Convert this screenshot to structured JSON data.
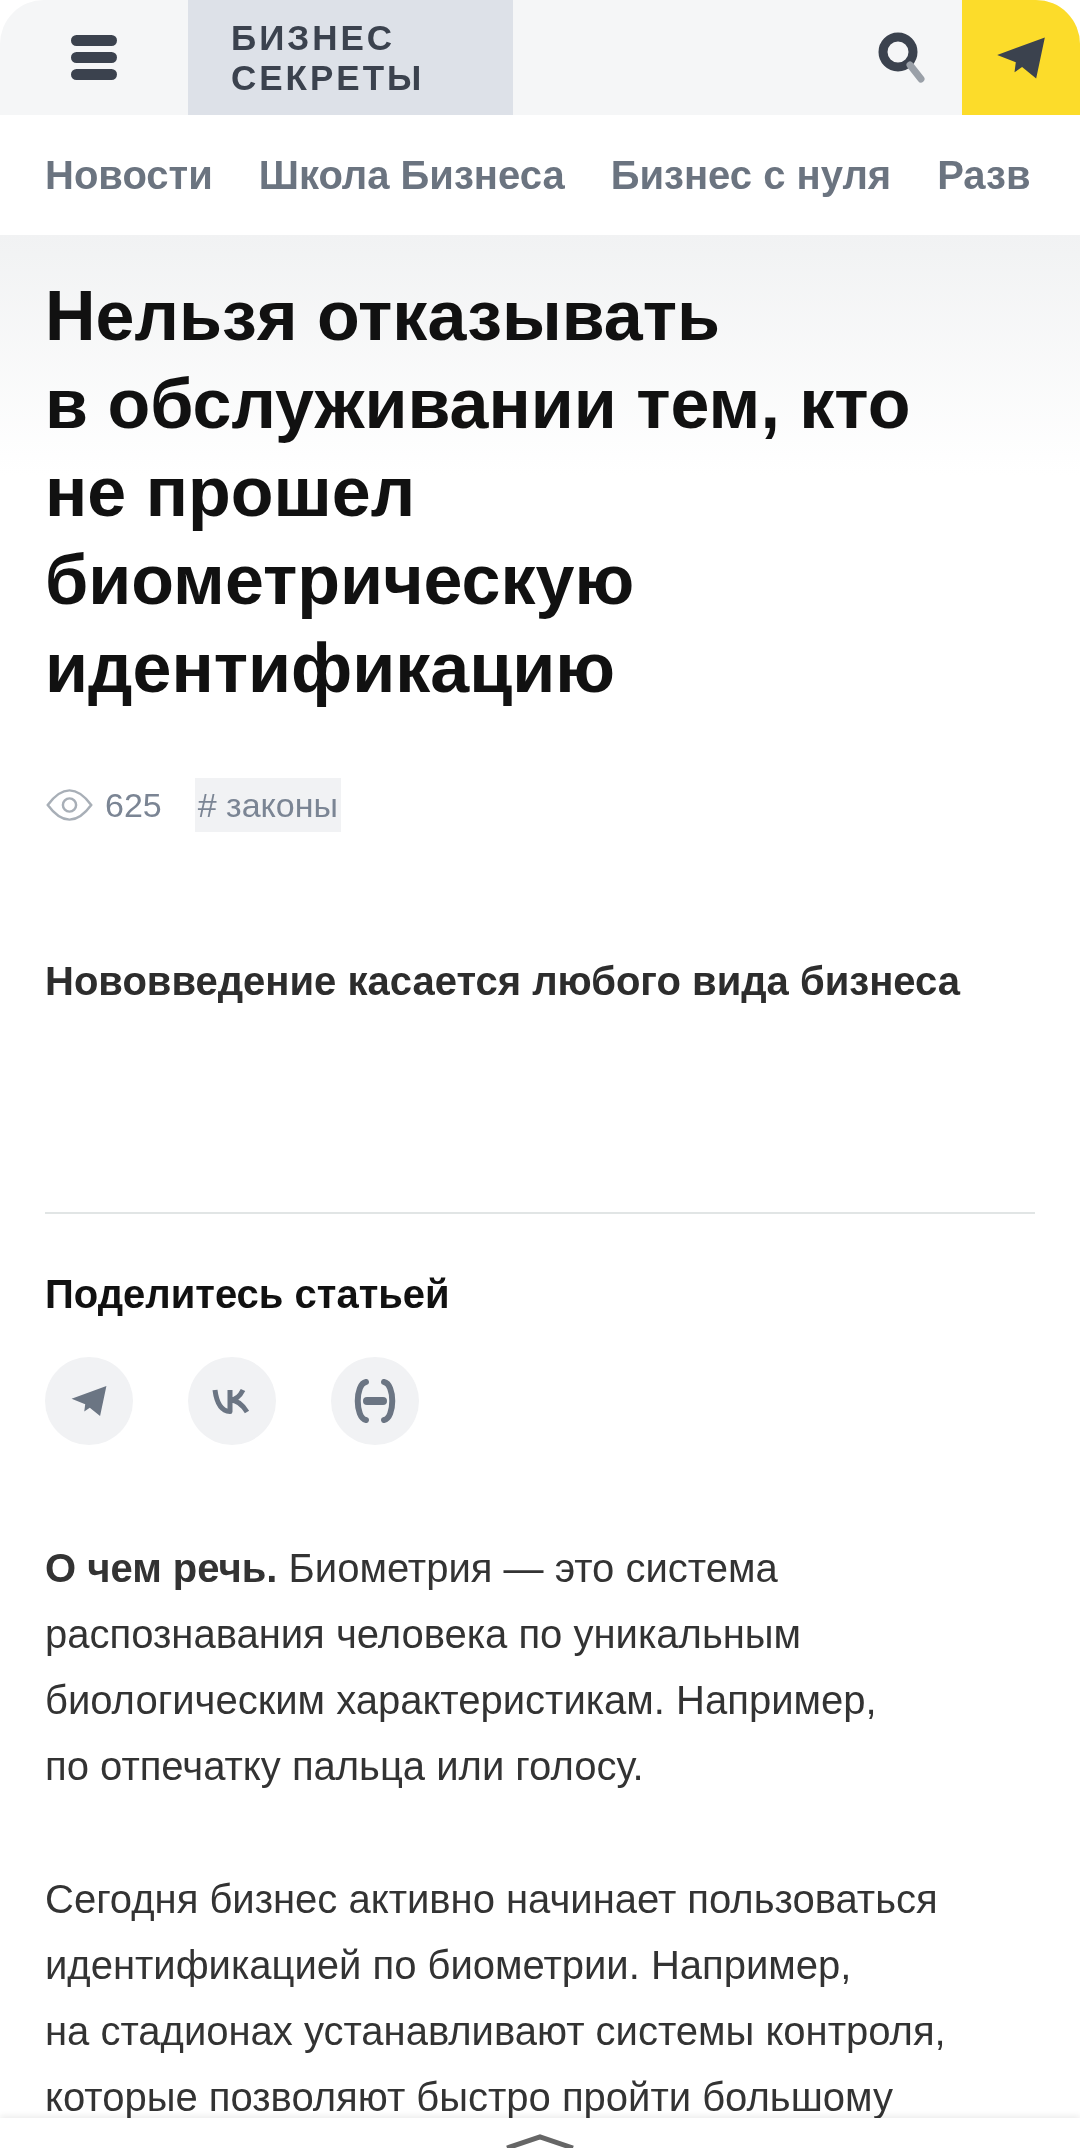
{
  "header": {
    "logo_lines": [
      "БИЗНЕС",
      "СЕКРЕТЫ"
    ]
  },
  "nav": [
    {
      "label": "Новости"
    },
    {
      "label": "Школа Бизнеса"
    },
    {
      "label": "Бизнес с нуля"
    },
    {
      "label": "Разв"
    }
  ],
  "article": {
    "title": "Нельзя отказывать в обслуживании тем, кто не прошел биометрическую идентификацию",
    "views": "625",
    "tags": [
      "# законы"
    ],
    "lead": "Нововведение касается любого вида бизнеса",
    "share": {
      "heading": "Поделитесь статьей",
      "buttons": [
        {
          "kind": "telegram"
        },
        {
          "kind": "vk"
        },
        {
          "kind": "link"
        }
      ]
    },
    "paragraphs": [
      "**О чем речь.** Биометрия — это система распознавания человека по уникальным биологическим характеристикам. Например, по отпечатку пальца или голосу.",
      "Сегодня бизнес активно начинает пользоваться идентификацией по биометрии. Например, на стадионах устанавливают системы контроля, которые позволяют быстро пройти большому"
    ]
  }
}
